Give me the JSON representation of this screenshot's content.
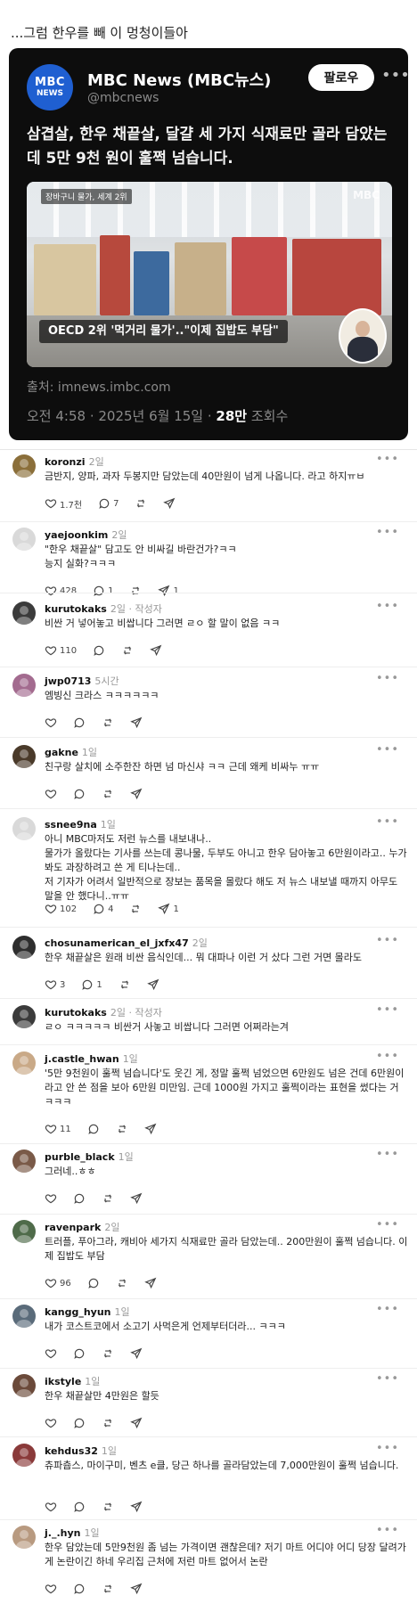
{
  "caption": "...그럼 한우를 빼 이 멍청이들아",
  "post": {
    "logo_line1": "MBC",
    "logo_line2": "NEWS",
    "author_name": "MBC News (MBC뉴스)",
    "handle": "@mbcnews",
    "follow_label": "팔로우",
    "headline": "삼겹살, 한우 채끝살, 달걀 세 가지 식재료만 골라 담았는데 5만 9천 원이 훌쩍 넘습니다.",
    "image_tag": "장바구니 물가, 세계 2위",
    "image_watermark": "MBC",
    "image_subtitle": "OECD 2위 '먹거리 물가'..\"이제 집밥도 부담\"",
    "source": "출처: imnews.imbc.com",
    "time": "오전 4:58 · 2025년 6월 15일 · ",
    "views_count": "28만",
    "views_label": " 조회수",
    "accent_color": "#1f5fd1"
  },
  "comments": [
    {
      "user": "koronzi",
      "time": "2일",
      "author_tag": "",
      "text": "금반지, 양파, 과자 두봉지만 담았는데 40만원이 넘게 나옵니다. 라고 하지ㅠㅂ",
      "likes": "1.7천",
      "replies": "7",
      "reposts": "",
      "shares": "",
      "avatar_color": "#8b6f3a"
    },
    {
      "user": "yaejoonkim",
      "time": "2일",
      "author_tag": "",
      "text": "\"한우 채끝살\" 담고도 안 비싸길 바란건가?ㅋㅋ\n능지 실화?ㅋㅋㅋ",
      "likes": "428",
      "replies": "1",
      "reposts": "",
      "shares": "1",
      "avatar_color": "#d9d9d9"
    },
    {
      "user": "kurutokaks",
      "time": "2일",
      "author_tag": "작성자",
      "text": "비싼 거 넣어놓고 비쌉니다 그러면 ㄹㅇ 할 말이 없음 ㅋㅋ",
      "likes": "110",
      "replies": "",
      "reposts": "",
      "shares": "",
      "avatar_color": "#3b3b3b"
    },
    {
      "user": "jwp0713",
      "time": "5시간",
      "author_tag": "",
      "text": "엠빙신 크라스 ㅋㅋㅋㅋㅋㅋ",
      "likes": "",
      "replies": "",
      "reposts": "",
      "shares": "",
      "avatar_color": "#a36b8f"
    },
    {
      "user": "gakne",
      "time": "1일",
      "author_tag": "",
      "text": "친구랑 살치에 소주한잔 하면 넘 마신샤 ㅋㅋ 근데 왜케 비싸누 ㅠㅠ",
      "likes": "",
      "replies": "",
      "reposts": "",
      "shares": "",
      "avatar_color": "#4a3a2a"
    },
    {
      "user": "ssnee9na",
      "time": "1일",
      "author_tag": "",
      "text": "아니 MBC마저도 저런 뉴스를 내보내나..\n물가가 올랐다는 기사를 쓰는데 콩나물, 두부도 아니고 한우 담아놓고 6만원이라고.. 누가 봐도 과장하려고 쓴 게 티나는데..\n저 기자가 어려서 일반적으로 장보는 품목을 몰랐다 해도 저 뉴스 내보낼 때까지 아무도 말을 안 했다니..ㅠㅠ",
      "likes": "102",
      "replies": "4",
      "reposts": "",
      "shares": "1",
      "avatar_color": "#d9d9d9"
    },
    {
      "user": "chosunamerican_el_jxfx47",
      "time": "2일",
      "author_tag": "",
      "text": "한우 채끝살은 원래 비싼 음식인데... 뭐 대파나 이런 거 샀다 그런 거면 몰라도",
      "likes": "3",
      "replies": "1",
      "reposts": "",
      "shares": "",
      "avatar_color": "#2e2e2e"
    },
    {
      "user": "kurutokaks",
      "time": "2일",
      "author_tag": "작성자",
      "text": "ㄹㅇ ㅋㅋㅋㅋㅋ 비싼거 사놓고 비쌉니다 그러면 어쩌라는겨",
      "likes": "",
      "replies": "",
      "reposts": "",
      "shares": "",
      "avatar_color": "#3b3b3b"
    },
    {
      "user": "j.castle_hwan",
      "time": "1일",
      "author_tag": "",
      "text": "'5만 9천원이 훌쩍 넘습니다'도 웃긴 게, 정말 훌쩍 넘었으면 6만원도 넘은 건데 6만원이라고 안 쓴 점을 보아 6만원 미만임. 근데 1000원 가지고 훌쩍이라는 표현을 썼다는 거 ㅋㅋㅋ",
      "likes": "11",
      "replies": "",
      "reposts": "",
      "shares": "",
      "avatar_color": "#c9a987"
    },
    {
      "user": "purble_black",
      "time": "1일",
      "author_tag": "",
      "text": "그러네..ㅎㅎ",
      "likes": "",
      "replies": "",
      "reposts": "",
      "shares": "",
      "avatar_color": "#7a5a48"
    },
    {
      "user": "ravenpark",
      "time": "2일",
      "author_tag": "",
      "text": "트러플, 푸아그라, 캐비아 세가지 식재료만 골라 담았는데.. 200만원이 훌쩍 넘습니다. 이제 집밥도 부담",
      "likes": "96",
      "replies": "",
      "reposts": "",
      "shares": "",
      "avatar_color": "#4f6b4a"
    },
    {
      "user": "kangg_hyun",
      "time": "1일",
      "author_tag": "",
      "text": "내가 코스트코에서 소고기 사먹은게 언제부터더라... ㅋㅋㅋ",
      "likes": "",
      "replies": "",
      "reposts": "",
      "shares": "",
      "avatar_color": "#5a6b7a"
    },
    {
      "user": "ikstyle",
      "time": "1일",
      "author_tag": "",
      "text": "한우 채끝살만 4만원은 할듯",
      "likes": "",
      "replies": "",
      "reposts": "",
      "shares": "",
      "avatar_color": "#6b4a3a"
    },
    {
      "user": "kehdus32",
      "time": "1일",
      "author_tag": "",
      "text": "츄파츕스, 마이구미, 벤츠 e클, 당근 하나를 골라담았는데 7,000만원이 훌쩍 넘습니다.",
      "likes": "",
      "replies": "",
      "reposts": "",
      "shares": "",
      "avatar_color": "#8a3a3a"
    },
    {
      "user": "j._.hyn",
      "time": "1일",
      "author_tag": "",
      "text": "한우 담았는데 5만9천원 좀 넘는 가격이면 괜찮은데? 저기 마트 어디야 어디 당장 달려가게 논란이긴 하네 우리집 근처에 저런 마트 없어서 논란",
      "likes": "",
      "replies": "",
      "reposts": "",
      "shares": "",
      "avatar_color": "#b89a80"
    }
  ]
}
